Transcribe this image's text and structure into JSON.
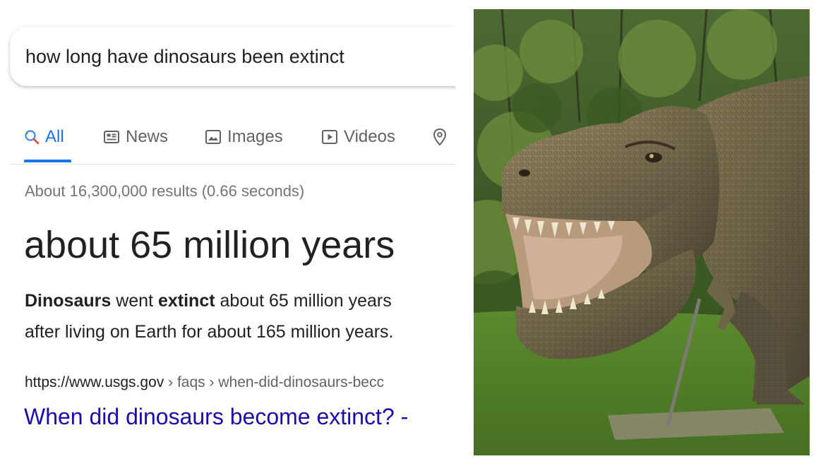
{
  "search": {
    "query": "how long have dinosaurs been extinct"
  },
  "tabs": [
    {
      "label": "All",
      "icon": "search-icon",
      "active": true
    },
    {
      "label": "News",
      "icon": "news-icon",
      "active": false
    },
    {
      "label": "Images",
      "icon": "image-icon",
      "active": false
    },
    {
      "label": "Videos",
      "icon": "video-icon",
      "active": false
    },
    {
      "label": "",
      "icon": "maps-pin-icon",
      "active": false
    }
  ],
  "results": {
    "stats": "About 16,300,000 results (0.66 seconds)",
    "answer": "about 65 million years",
    "snippet": {
      "line1_bold1": "Dinosaurs",
      "line1_text1": " went ",
      "line1_bold2": "extinct",
      "line1_text2": " about 65 million years ",
      "line2": "after living on Earth for about 165 million years."
    },
    "source": {
      "url": "https://www.usgs.gov",
      "crumb1": "faqs",
      "crumb2": "when-did-dinosaurs-becc",
      "separator": "›"
    },
    "title": "When did dinosaurs become extinct? -"
  },
  "photo": {
    "subject": "tyrannosaurus rex statue in forest clearing"
  },
  "colors": {
    "link": "#1a0dab",
    "accent": "#1a73e8",
    "muted": "#70757a",
    "text": "#202124"
  }
}
